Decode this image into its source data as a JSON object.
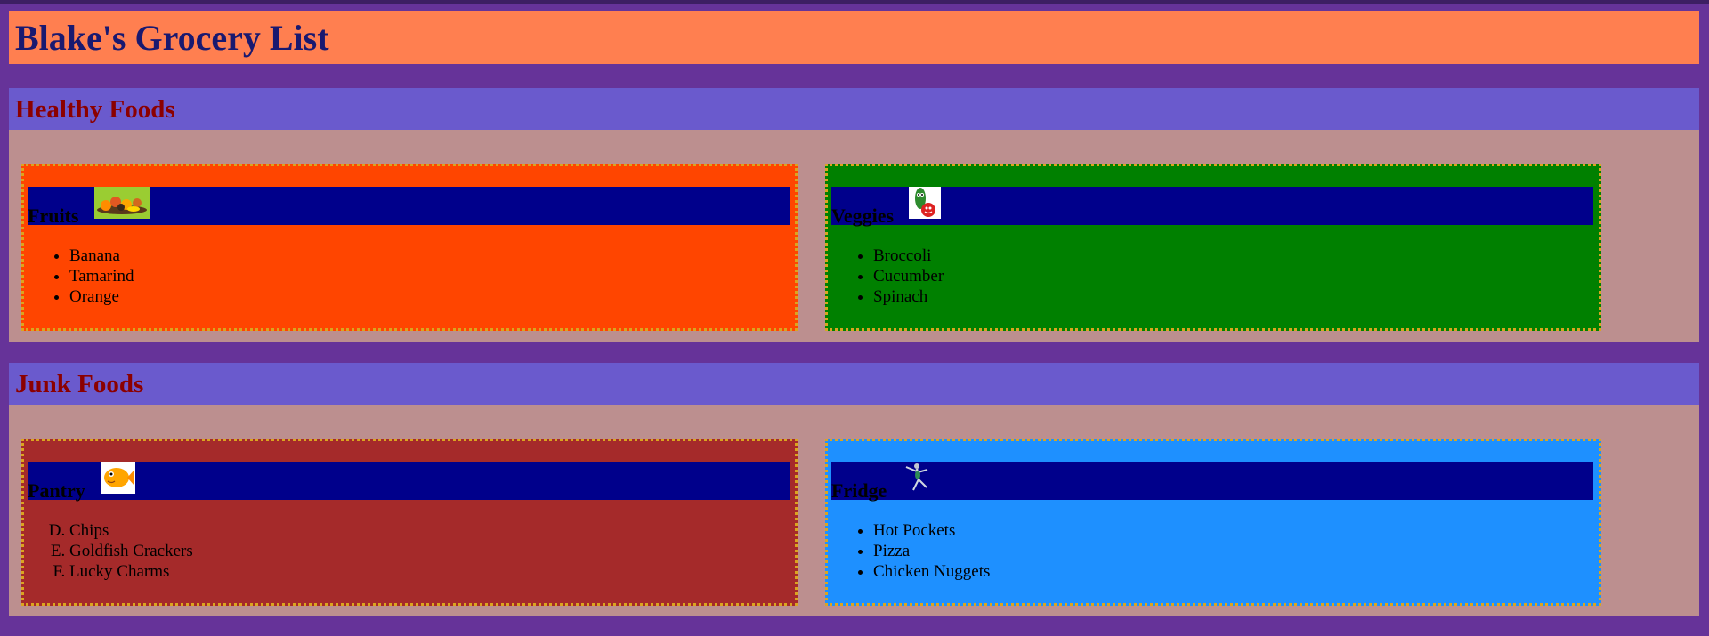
{
  "page": {
    "title": "Blake's Grocery List"
  },
  "sections": [
    {
      "heading": "Healthy Foods",
      "cards": [
        {
          "title": "Fruits",
          "icon": "fruit-basket-icon",
          "bg": "#ff4500",
          "items": [
            "Banana",
            "Tamarind",
            "Orange"
          ]
        },
        {
          "title": "Veggies",
          "icon": "cucumber-tomato-icon",
          "bg": "#008000",
          "items": [
            "Broccoli",
            "Cucumber",
            "Spinach"
          ]
        }
      ]
    },
    {
      "heading": "Junk Foods",
      "cards": [
        {
          "title": "Pantry",
          "icon": "goldfish-cracker-icon",
          "bg": "#a52a2a",
          "list_start_letter": "D",
          "items": [
            "Chips",
            "Goldfish Crackers",
            "Lucky Charms"
          ]
        },
        {
          "title": "Fridge",
          "icon": "dancing-figure-icon",
          "bg": "#1e90ff",
          "items": [
            "Hot Pockets",
            "Pizza",
            "Chicken Nuggets"
          ]
        }
      ]
    }
  ],
  "colors": {
    "page_background": "#663399",
    "title_bar": "#ff7f50",
    "title_text": "#191970",
    "section_header": "#6a5acd",
    "section_heading_text": "#8b0000",
    "section_body": "#bc8f8f",
    "card_header_bar": "#00008b",
    "card_border": "#daa520"
  }
}
